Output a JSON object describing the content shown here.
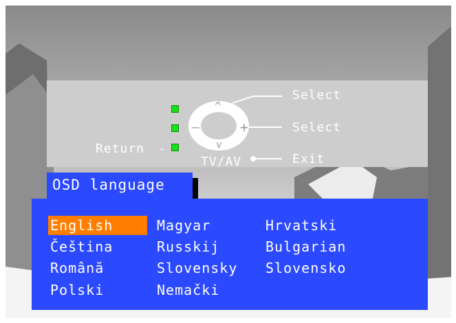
{
  "help": {
    "select_up": "Select",
    "select_side": "Select",
    "exit": "Exit",
    "return": "Return",
    "return_dash": "-",
    "tv_av": "TV/AV",
    "dpad_up": "^",
    "dpad_left": "–",
    "dpad_right": "+",
    "dpad_down": "v"
  },
  "menu": {
    "title": "OSD language",
    "selected": "English",
    "languages": [
      "English",
      "Čeština",
      "Română",
      "Polski",
      "Magyar",
      "Russkij",
      "Slovensky",
      "Nemački",
      "Hrvatski",
      "Bulgarian",
      "Slovensko"
    ]
  },
  "colors": {
    "menu_blue": "#2b49ff",
    "highlight_orange": "#ff7e00",
    "indicator_green": "#19e019",
    "panel_grey": "#cdcdcd"
  }
}
